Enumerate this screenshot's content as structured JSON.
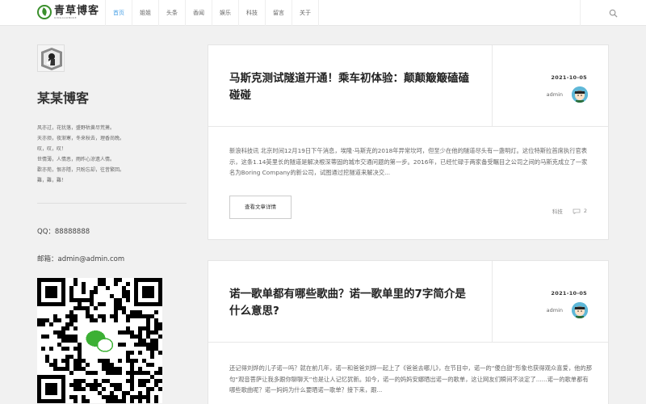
{
  "header": {
    "logo_title": "青草博客",
    "logo_sub": "QINGCAOBOKE",
    "nav": [
      "首页",
      "姐姐",
      "头条",
      "香闻",
      "娱乐",
      "科技",
      "留言",
      "关于"
    ]
  },
  "sidebar": {
    "blog_name": "某某博客",
    "poem": [
      "风亦过，花犹落，盛野枯黄尽荒萧。",
      "天亦烦，夜渐寒，冬来秋去，理香尚晚。",
      "叹，叹，叹！",
      "世情薄，人情恶，雨昨心涼遗人情。",
      "歡亦苑，恨亦隱，只盼忘却，往昔繁回。",
      "難，難，難！"
    ],
    "qq_label": "QQ：88888888",
    "mail_label": "邮箱：admin@admin.com"
  },
  "articles": [
    {
      "title": "马斯克测试隧道开通！乘车初体验：颠颠簸簸磕磕碰碰",
      "date": "2021-10-05",
      "author": "admin",
      "excerpt": "新浪科技讯 北京时间12月19日下午消息，埃隆·马斯克的2018年异常坎坷，但至少在他的隧道尽头有一盏明灯。这位特斯拉首席执行官表示，这条1.14英里长的隧道是解决根深蒂固的城市交通问题的第一步。2016年，已经忙碌于两家备受瞩目之公司之间的马斯克成立了一家名为Boring Company的新公司，试图通过挖隧道来解决交...",
      "read_more": "查看文章详情",
      "tag": "科技",
      "comments": "2"
    },
    {
      "title": "诺一歌单都有哪些歌曲？诺一歌单里的7字简介是什么意思?",
      "date": "2021-10-05",
      "author": "admin",
      "excerpt": "还记得刘烨的儿子诺一吗？就在前几年，诺一和爸爸刘烨一起上了《爸爸去哪儿》，在节目中，诺一的“傻白甜”形象也获得观众喜爱，他的那句“观音菩萨让我多跟你聊聊天”也是让人记忆犹新。如今，诺一的妈妈安娜晒出诺一的歌单，这让网友们瞬间不淡定了......诺一的歌单都有哪些歌曲呢？诺一妈妈为什么要晒诺一歌单？接下来，跟..."
    }
  ]
}
